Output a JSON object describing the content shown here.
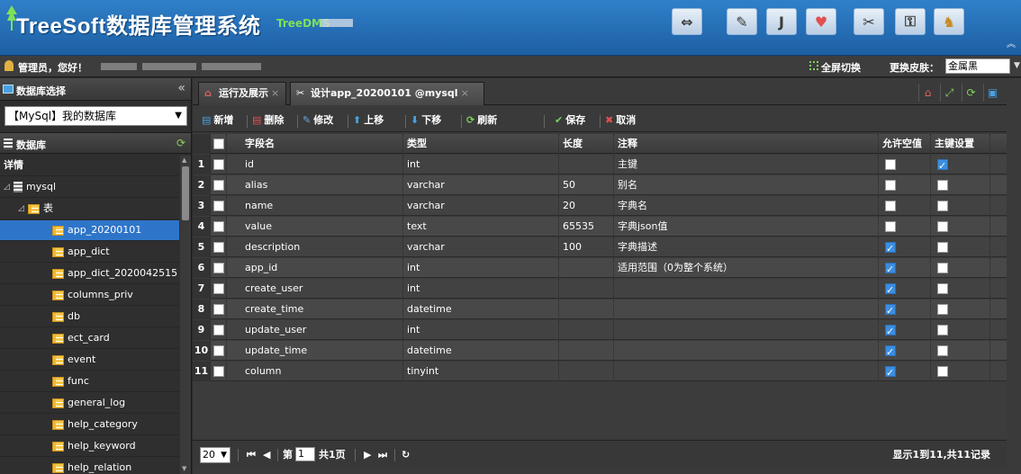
{
  "header": {
    "title": "TreeSoft数据库管理系统",
    "subtitle": "TreeDMS",
    "icons": [
      "arrows-icon",
      "edit-icon",
      "java-icon",
      "heart-icon",
      "tools-icon",
      "key-icon",
      "user-icon"
    ],
    "accent_color": "#2f80c9"
  },
  "userbar": {
    "greeting": "管理员，您好！",
    "fullscreen_label": "全屏切换",
    "skin_label": "更换皮肤：",
    "skin_value": "金属黑"
  },
  "sidebar": {
    "title": "数据库选择",
    "db_select_value": "【MySql】我的数据库",
    "section_title": "数据库",
    "tree": [
      {
        "label": "详情",
        "level": 0,
        "type": "plain"
      },
      {
        "label": "mysql",
        "level": 0,
        "type": "db"
      },
      {
        "label": "表",
        "level": 1,
        "type": "folder"
      },
      {
        "label": "app_20200101",
        "level": 2,
        "type": "table",
        "selected": true
      },
      {
        "label": "app_dict",
        "level": 2,
        "type": "table"
      },
      {
        "label": "app_dict_2020042515",
        "level": 2,
        "type": "table"
      },
      {
        "label": "columns_priv",
        "level": 2,
        "type": "table"
      },
      {
        "label": "db",
        "level": 2,
        "type": "table"
      },
      {
        "label": "ect_card",
        "level": 2,
        "type": "table"
      },
      {
        "label": "event",
        "level": 2,
        "type": "table"
      },
      {
        "label": "func",
        "level": 2,
        "type": "table"
      },
      {
        "label": "general_log",
        "level": 2,
        "type": "table"
      },
      {
        "label": "help_category",
        "level": 2,
        "type": "table"
      },
      {
        "label": "help_keyword",
        "level": 2,
        "type": "table"
      },
      {
        "label": "help_relation",
        "level": 2,
        "type": "table"
      }
    ]
  },
  "tabs": [
    {
      "label": "运行及展示",
      "icon": "home-icon"
    },
    {
      "label": "设计app_20200101 @mysql",
      "icon": "tools-icon",
      "active": true
    }
  ],
  "toolbar": {
    "add": "新增",
    "delete": "删除",
    "edit": "修改",
    "move_up": "上移",
    "move_down": "下移",
    "refresh": "刷新",
    "save": "保存",
    "cancel": "取消"
  },
  "grid": {
    "columns": [
      "字段名",
      "类型",
      "长度",
      "注释",
      "允许空值",
      "主键设置"
    ],
    "rows": [
      {
        "n": "1",
        "name": "id",
        "type": "int",
        "length": "",
        "comment": "主键",
        "nullable": false,
        "pk": true
      },
      {
        "n": "2",
        "name": "alias",
        "type": "varchar",
        "length": "50",
        "comment": "别名",
        "nullable": false,
        "pk": false
      },
      {
        "n": "3",
        "name": "name",
        "type": "varchar",
        "length": "20",
        "comment": "字典名",
        "nullable": false,
        "pk": false
      },
      {
        "n": "4",
        "name": "value",
        "type": "text",
        "length": "65535",
        "comment": "字典json值",
        "nullable": false,
        "pk": false
      },
      {
        "n": "5",
        "name": "description",
        "type": "varchar",
        "length": "100",
        "comment": "字典描述",
        "nullable": true,
        "pk": false
      },
      {
        "n": "6",
        "name": "app_id",
        "type": "int",
        "length": "",
        "comment": "适用范围（0为整个系统）",
        "nullable": true,
        "pk": false
      },
      {
        "n": "7",
        "name": "create_user",
        "type": "int",
        "length": "",
        "comment": "",
        "nullable": true,
        "pk": false
      },
      {
        "n": "8",
        "name": "create_time",
        "type": "datetime",
        "length": "",
        "comment": "",
        "nullable": true,
        "pk": false
      },
      {
        "n": "9",
        "name": "update_user",
        "type": "int",
        "length": "",
        "comment": "",
        "nullable": true,
        "pk": false
      },
      {
        "n": "10",
        "name": "update_time",
        "type": "datetime",
        "length": "",
        "comment": "",
        "nullable": true,
        "pk": false
      },
      {
        "n": "11",
        "name": "column",
        "type": "tinyint",
        "length": "",
        "comment": "",
        "nullable": true,
        "pk": false
      }
    ]
  },
  "pager": {
    "page_size": "20",
    "page_prefix": "第",
    "page_value": "1",
    "page_total": "共1页",
    "summary": "显示1到11,共11记录"
  }
}
